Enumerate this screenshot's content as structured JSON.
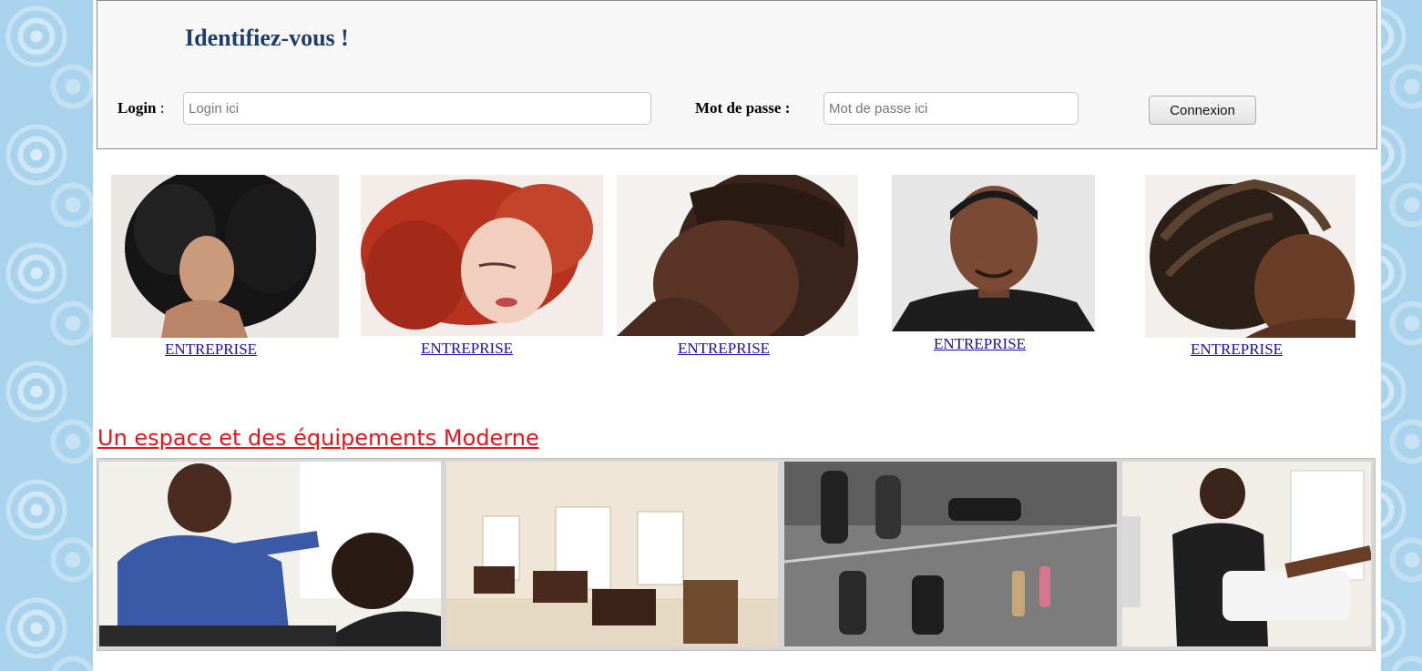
{
  "login": {
    "title": "Identifiez-vous !",
    "login_label": "Login",
    "login_colon": " :",
    "login_placeholder": "Login ici",
    "password_label": "Mot de passe :",
    "password_placeholder": "Mot de passe ici",
    "submit_label": "Connexion"
  },
  "cards": [
    {
      "link": "ENTREPRISE",
      "icon": "curly-hair-woman-photo"
    },
    {
      "link": "ENTREPRISE",
      "icon": "red-hair-woman-photo"
    },
    {
      "link": "ENTREPRISE",
      "icon": "man-haircut-profile-photo"
    },
    {
      "link": "ENTREPRISE",
      "icon": "man-portrait-photo"
    },
    {
      "link": "ENTREPRISE",
      "icon": "braided-hair-woman-photo"
    }
  ],
  "section": {
    "title": "Un espace et des équipements Moderne"
  },
  "gallery": [
    {
      "icon": "barber-cutting-hair-photo"
    },
    {
      "icon": "salon-interior-photo"
    },
    {
      "icon": "clippers-display-photo"
    },
    {
      "icon": "pedicure-photo"
    }
  ],
  "colors": {
    "title": "#1c3d6e",
    "section_title": "#e8141a",
    "link": "#1a0dab",
    "background": "#a9d3ec"
  }
}
